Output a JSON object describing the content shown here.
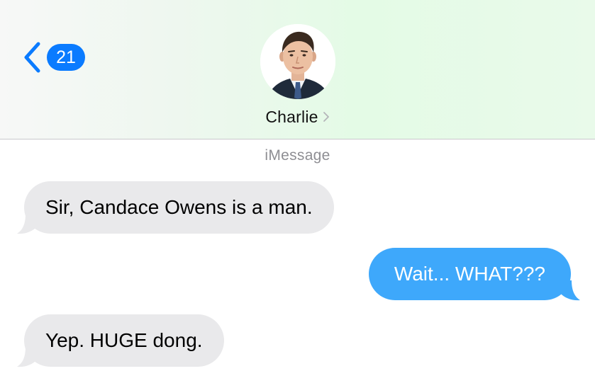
{
  "header": {
    "unread_count": "21",
    "contact_name": "Charlie",
    "back_icon": "chevron-left-icon",
    "contact_icon": "chevron-right-icon"
  },
  "thread": {
    "service_label": "iMessage",
    "messages": [
      {
        "direction": "incoming",
        "text": "Sir, Candace Owens is a man."
      },
      {
        "direction": "outgoing",
        "text": "Wait... WHAT???"
      },
      {
        "direction": "incoming",
        "text": "Yep. HUGE dong."
      }
    ]
  },
  "colors": {
    "accent": "#0a7bff",
    "outgoing_bubble": "#3ea8fb",
    "incoming_bubble": "#e9e9eb",
    "secondary_text": "#8e8e93"
  }
}
